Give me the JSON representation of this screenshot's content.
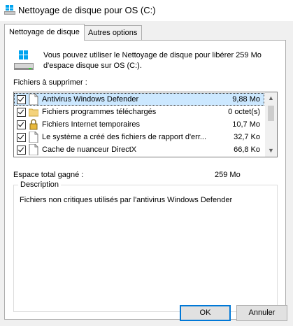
{
  "window": {
    "title": "Nettoyage de disque pour OS (C:)",
    "icon": "disk-cleanup-icon"
  },
  "tabs": [
    {
      "label": "Nettoyage de disque",
      "active": true
    },
    {
      "label": "Autres options",
      "active": false
    }
  ],
  "intro": {
    "text": "Vous pouvez utiliser le Nettoyage de disque pour libérer 259 Mo d'espace disque sur OS (C:)."
  },
  "files": {
    "label": "Fichiers à supprimer :",
    "items": [
      {
        "name": "Antivirus Windows Defender",
        "size": "9,88 Mo",
        "checked": true,
        "icon": "file-icon",
        "selected": true
      },
      {
        "name": "Fichiers programmes téléchargés",
        "size": "0 octet(s)",
        "checked": true,
        "icon": "folder-icon",
        "selected": false
      },
      {
        "name": "Fichiers Internet temporaires",
        "size": "10,7 Mo",
        "checked": true,
        "icon": "lock-icon",
        "selected": false
      },
      {
        "name": "Le système a créé des fichiers de rapport d'err...",
        "size": "32,7 Ko",
        "checked": true,
        "icon": "file-icon",
        "selected": false
      },
      {
        "name": "Cache de nuanceur DirectX",
        "size": "66,8 Ko",
        "checked": true,
        "icon": "file-icon",
        "selected": false
      }
    ]
  },
  "gain": {
    "label": "Espace total gagné :",
    "value": "259 Mo"
  },
  "description": {
    "title": "Description",
    "text": "Fichiers non critiques utilisés par l'antivirus Windows Defender"
  },
  "buttons": {
    "ok": "OK",
    "cancel": "Annuler"
  },
  "colors": {
    "selection": "#cce8ff",
    "accent": "#0078d7",
    "windows_blue": "#00a4ef"
  }
}
